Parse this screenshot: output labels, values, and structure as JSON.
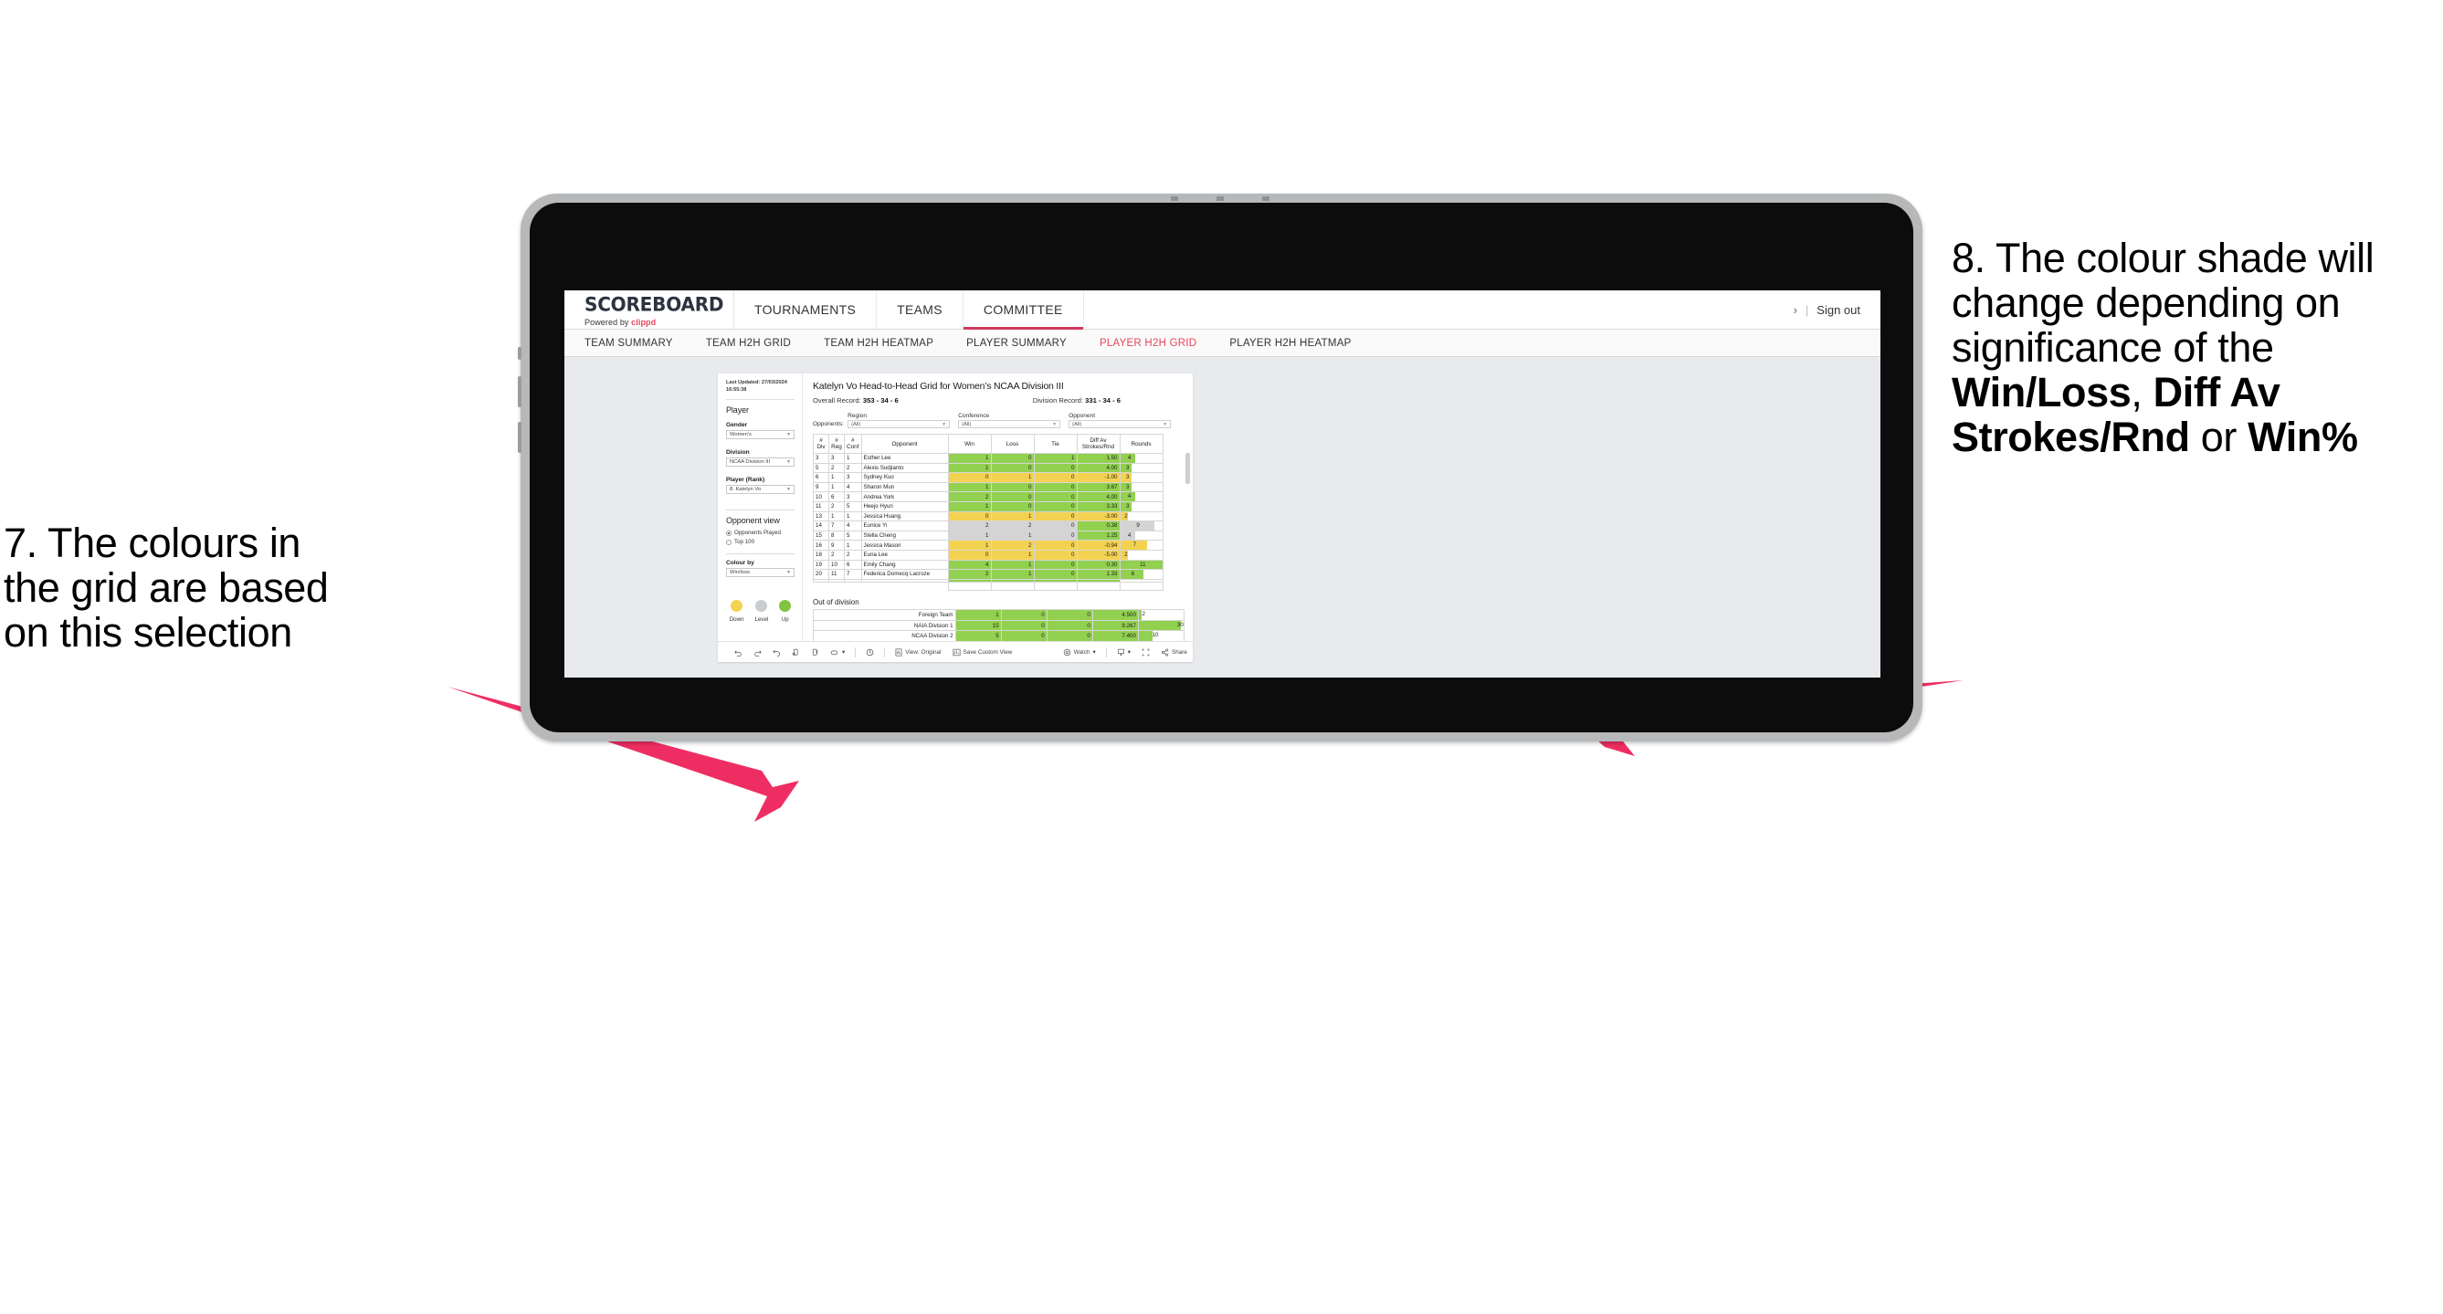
{
  "annotations": {
    "left": {
      "lines": [
        "7. The colours in",
        "the grid are based",
        "on this selection"
      ]
    },
    "right": {
      "seg1": "8. The colour shade will change depending on significance of the ",
      "bold1": "Win/Loss",
      "mid1": ", ",
      "bold2": "Diff Av Strokes/Rnd",
      "mid2": " or ",
      "bold3": "Win%"
    },
    "arrow_color": "#ee2e62"
  },
  "topnav": {
    "brand_name": "SCOREBOARD",
    "brand_sub_prefix": "Powered by ",
    "brand_sub_link": "clippd",
    "items": [
      {
        "label": "TOURNAMENTS",
        "active": false
      },
      {
        "label": "TEAMS",
        "active": false
      },
      {
        "label": "COMMITTEE",
        "active": true
      }
    ],
    "chevron": "›",
    "divider": "|",
    "signout": "Sign out",
    "accent": "#d13a5e"
  },
  "subnav": {
    "items": [
      {
        "label": "TEAM SUMMARY",
        "active": false
      },
      {
        "label": "TEAM H2H GRID",
        "active": false
      },
      {
        "label": "TEAM H2H HEATMAP",
        "active": false
      },
      {
        "label": "PLAYER SUMMARY",
        "active": false
      },
      {
        "label": "PLAYER H2H GRID",
        "active": true
      },
      {
        "label": "PLAYER H2H HEATMAP",
        "active": false
      }
    ]
  },
  "sidebar": {
    "last_updated": "Last Updated: 27/03/2024 16:55:38",
    "player_heading": "Player",
    "gender_label": "Gender",
    "gender_value": "Women’s",
    "division_label": "Division",
    "division_value": "NCAA Division III",
    "player_rank_label": "Player (Rank)",
    "player_rank_value": "8. Katelyn Vo",
    "opponent_view_heading": "Opponent view",
    "radio_played": "Opponents Played",
    "radio_top100": "Top 100",
    "colour_by_label": "Colour by",
    "colour_by_value": "Win/loss",
    "legend": [
      {
        "label": "Down",
        "color": "#f4d251"
      },
      {
        "label": "Level",
        "color": "#c9ccd0"
      },
      {
        "label": "Up",
        "color": "#82c341"
      }
    ]
  },
  "content": {
    "title": "Katelyn Vo Head-to-Head Grid for Women’s NCAA Division III",
    "overall_record_label": "Overall Record: ",
    "overall_record_value": "353 -  34 - 6",
    "division_record_label": "Division Record: ",
    "division_record_value": "331 -  34 - 6",
    "opponents_label": "Opponents:",
    "filters": [
      {
        "label": "Region",
        "value": "(All)"
      },
      {
        "label": "Conference",
        "value": "(All)"
      },
      {
        "label": "Opponent",
        "value": "(All)"
      }
    ],
    "out_of_division_heading": "Out of division"
  },
  "chart_data": {
    "type": "table",
    "title": "Katelyn Vo Head-to-Head Grid for Women’s NCAA Division III",
    "columns": [
      "# Div",
      "# Reg",
      "# Conf",
      "Opponent",
      "Win",
      "Loss",
      "Tie",
      "Diff Av Strokes/Rnd",
      "Rounds"
    ],
    "column_header_lines": [
      [
        "#",
        "Div"
      ],
      [
        "#",
        "Reg"
      ],
      [
        "#",
        "Conf"
      ],
      [
        "Opponent",
        ""
      ],
      [
        "Win",
        ""
      ],
      [
        "Loss",
        ""
      ],
      [
        "Tie",
        ""
      ],
      [
        "Diff Av",
        "Strokes/Rnd"
      ],
      [
        "Rounds",
        ""
      ]
    ],
    "rows": [
      {
        "div": "3",
        "reg": "3",
        "conf": "1",
        "opponent": "Esther Lee",
        "win": "1",
        "loss": "0",
        "tie": "1",
        "diff": "1.50",
        "rounds": "4",
        "rounds_pct": 36,
        "shade": "g"
      },
      {
        "div": "5",
        "reg": "2",
        "conf": "2",
        "opponent": "Alexis Sudjianto",
        "win": "1",
        "loss": "0",
        "tie": "0",
        "diff": "4.00",
        "rounds": "3",
        "rounds_pct": 27,
        "shade": "g"
      },
      {
        "div": "6",
        "reg": "1",
        "conf": "3",
        "opponent": "Sydney Kuo",
        "win": "0",
        "loss": "1",
        "tie": "0",
        "diff": "-1.00",
        "rounds": "3",
        "rounds_pct": 27,
        "shade": "y"
      },
      {
        "div": "9",
        "reg": "1",
        "conf": "4",
        "opponent": "Sharon Mun",
        "win": "1",
        "loss": "0",
        "tie": "0",
        "diff": "3.67",
        "rounds": "3",
        "rounds_pct": 27,
        "shade": "g"
      },
      {
        "div": "10",
        "reg": "6",
        "conf": "3",
        "opponent": "Andrea York",
        "win": "2",
        "loss": "0",
        "tie": "0",
        "diff": "4.00",
        "rounds": "4",
        "rounds_pct": 36,
        "shade": "g"
      },
      {
        "div": "11",
        "reg": "2",
        "conf": "5",
        "opponent": "Heejo Hyun",
        "win": "1",
        "loss": "0",
        "tie": "0",
        "diff": "3.33",
        "rounds": "3",
        "rounds_pct": 27,
        "shade": "g"
      },
      {
        "div": "13",
        "reg": "1",
        "conf": "1",
        "opponent": "Jessica Huang",
        "win": "0",
        "loss": "1",
        "tie": "0",
        "diff": "-3.00",
        "rounds": "2",
        "rounds_pct": 18,
        "shade": "y"
      },
      {
        "div": "14",
        "reg": "7",
        "conf": "4",
        "opponent": "Eunice Yi",
        "win": "2",
        "loss": "2",
        "tie": "0",
        "diff": "0.38",
        "rounds": "9",
        "rounds_pct": 82,
        "shade": "n",
        "diff_shade": "g"
      },
      {
        "div": "15",
        "reg": "8",
        "conf": "5",
        "opponent": "Stella Cheng",
        "win": "1",
        "loss": "1",
        "tie": "0",
        "diff": "1.25",
        "rounds": "4",
        "rounds_pct": 36,
        "shade": "n",
        "diff_shade": "g"
      },
      {
        "div": "16",
        "reg": "9",
        "conf": "1",
        "opponent": "Jessica Mason",
        "win": "1",
        "loss": "2",
        "tie": "0",
        "diff": "-0.94",
        "rounds": "7",
        "rounds_pct": 64,
        "shade": "y"
      },
      {
        "div": "18",
        "reg": "2",
        "conf": "2",
        "opponent": "Euna Lee",
        "win": "0",
        "loss": "1",
        "tie": "0",
        "diff": "-5.00",
        "rounds": "2",
        "rounds_pct": 18,
        "shade": "y"
      },
      {
        "div": "19",
        "reg": "10",
        "conf": "6",
        "opponent": "Emily Chang",
        "win": "4",
        "loss": "1",
        "tie": "0",
        "diff": "0.30",
        "rounds": "11",
        "rounds_pct": 100,
        "shade": "g"
      },
      {
        "div": "20",
        "reg": "11",
        "conf": "7",
        "opponent": "Federica Domecq Lacroze",
        "win": "2",
        "loss": "1",
        "tie": "0",
        "diff": "1.33",
        "rounds": "6",
        "rounds_pct": 55,
        "shade": "g"
      }
    ],
    "out_of_division": {
      "heading": "Out of division",
      "rows": [
        {
          "name": "Foreign Team",
          "win": "1",
          "loss": "0",
          "tie": "0",
          "diff": "4.500",
          "rounds": "2",
          "rounds_pct": 6,
          "shade": "g"
        },
        {
          "name": "NAIA Division 1",
          "win": "15",
          "loss": "0",
          "tie": "0",
          "diff": "9.267",
          "rounds": "30",
          "rounds_pct": 93,
          "shade": "g"
        },
        {
          "name": "NCAA Division 2",
          "win": "5",
          "loss": "0",
          "tie": "0",
          "diff": "7.400",
          "rounds": "10",
          "rounds_pct": 31,
          "shade": "g"
        }
      ]
    },
    "colors": {
      "up": "#92d050",
      "down": "#f4d251",
      "level": "#d4d4d4"
    }
  },
  "toolbar": {
    "view_label": "View: Original",
    "save_label": "Save Custom View",
    "watch_label": "Watch",
    "share_label": "Share",
    "caret": "▾"
  }
}
